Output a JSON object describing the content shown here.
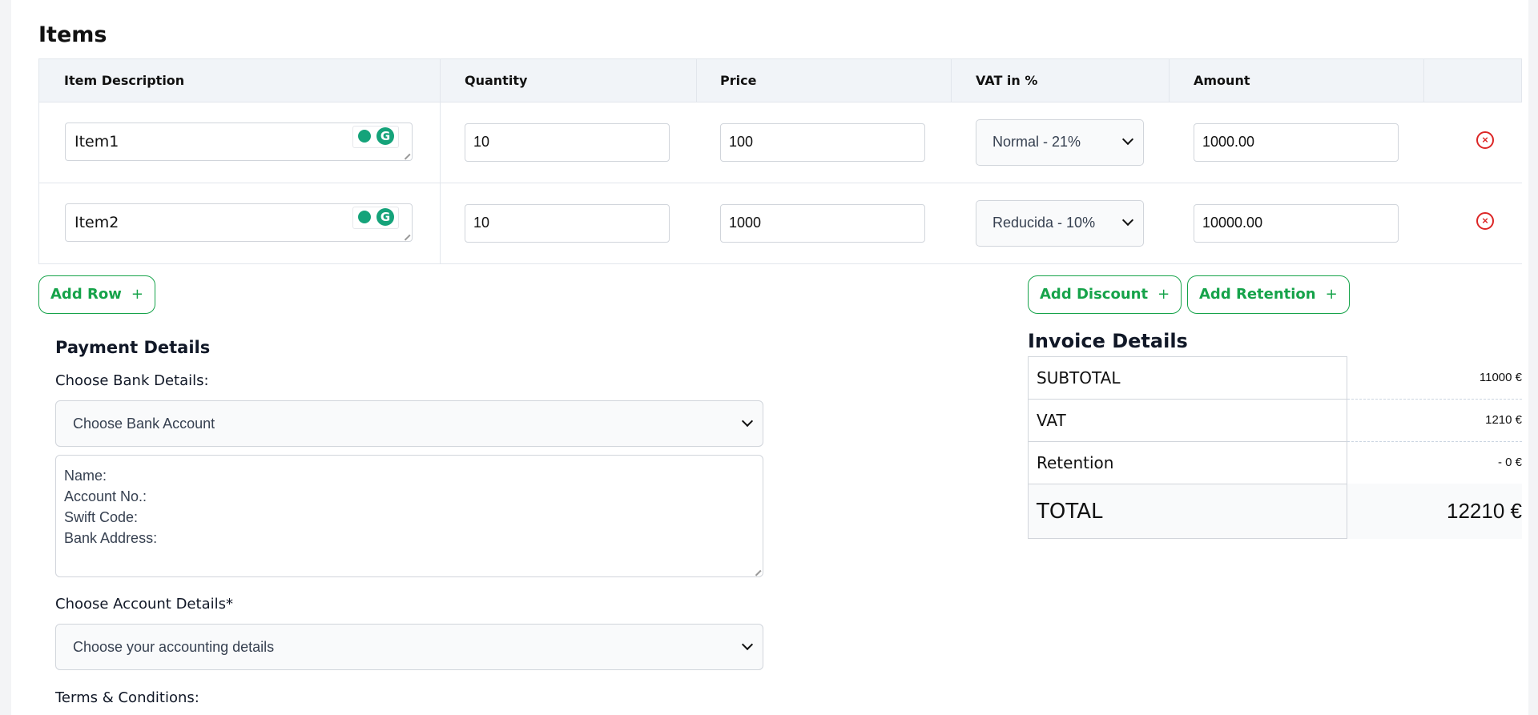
{
  "items_section": {
    "title": "Items"
  },
  "table": {
    "headers": [
      "Item Description",
      "Quantity",
      "Price",
      "VAT in %",
      "Amount"
    ],
    "rows": [
      {
        "description": "Item1",
        "quantity": "10",
        "price": "100",
        "vat": "Normal - 21%",
        "amount": "1000.00"
      },
      {
        "description": "Item2",
        "quantity": "10",
        "price": "1000",
        "vat": "Reducida - 10%",
        "amount": "10000.00"
      }
    ]
  },
  "actions": {
    "add_row": "Add Row",
    "add_discount": "Add Discount",
    "add_retention": "Add Retention",
    "plus": "+"
  },
  "grammarly": {
    "letter": "G"
  },
  "payment": {
    "title": "Payment Details",
    "bank_label": "Choose Bank Details:",
    "bank_select": "Choose Bank Account",
    "bank_fields": [
      "Name:",
      "Account No.:",
      "Swift Code:",
      "Bank Address:"
    ],
    "account_label": "Choose Account Details*",
    "account_select": "Choose your accounting details",
    "terms_label": "Terms & Conditions:"
  },
  "invoice": {
    "title": "Invoice Details",
    "subtotal_label": "SUBTOTAL",
    "subtotal": "11000 €",
    "vat_label": "VAT",
    "vat": "1210 €",
    "retention_label": "Retention",
    "retention": "- 0 €",
    "total_label": "TOTAL",
    "total": "12210 €"
  },
  "colors": {
    "accent": "#16a34a",
    "remove": "#dc2626",
    "grammarly": "#15a37a"
  }
}
